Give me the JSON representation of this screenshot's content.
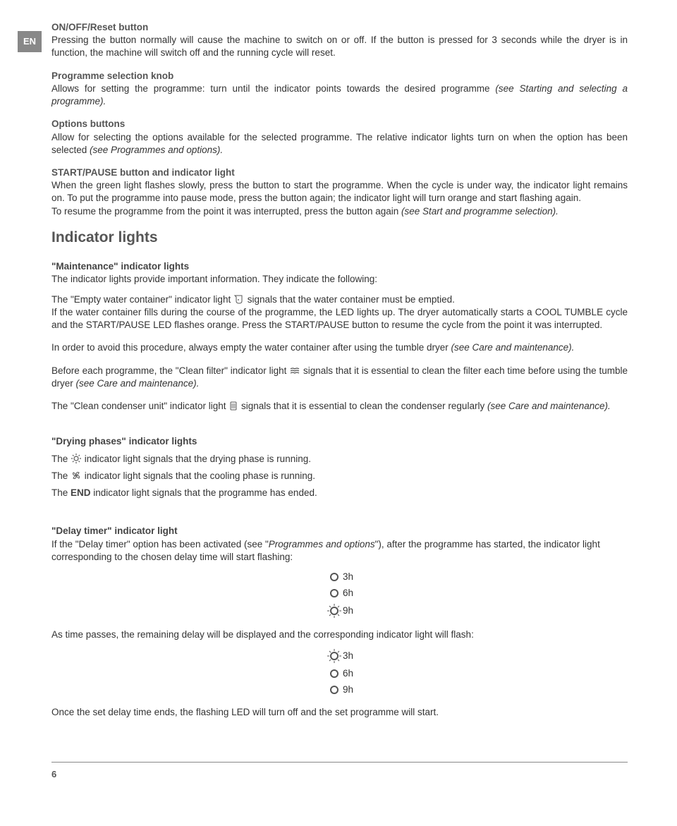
{
  "langBadge": "EN",
  "sections": {
    "onoff": {
      "title": "ON/OFF/Reset button",
      "body_a": "Pressing the button normally will cause the machine to switch on or off. If the button is pressed for 3 seconds while the dryer is in function, the machine will switch off and the running cycle will reset."
    },
    "progKnob": {
      "title": "Programme selection knob",
      "body_a": "Allows for setting the programme: turn until the indicator points towards the desired programme ",
      "body_i": "(see Starting and selecting a programme)."
    },
    "options": {
      "title": "Options buttons",
      "body_a": "Allow for selecting the options available for the selected programme. The relative indicator lights turn on when the option has been selected ",
      "body_i": "(see Programmes and options)."
    },
    "startPause": {
      "title": "START/PAUSE button and indicator light",
      "body_a": "When the green light flashes slowly, press the button to start the programme. When the cycle is under way, the indicator light remains on. To put the programme into pause mode, press the button again; the indicator light will turn orange and start flashing again.",
      "body_b": "To resume the programme from the point it was interrupted, press the button again ",
      "body_i": "(see Start and programme selection)."
    }
  },
  "indicatorHeading": "Indicator lights",
  "maintenance": {
    "subhead": "\"Maintenance\" indicator lights",
    "line1": "The indicator lights provide important information. They indicate the following:",
    "empty_a": "The \"Empty water container\" indicator light ",
    "empty_b": " signals that the water container must be emptied.",
    "empty_c": "If the water container fills during the course of the programme, the LED lights up. The dryer automatically starts a COOL TUMBLE cycle and the START/PAUSE LED flashes orange. Press the START/PAUSE button to resume the cycle from the point it was interrupted.",
    "avoid_a": "In order to avoid this procedure, always empty the water container after using the tumble dryer ",
    "avoid_i": "(see Care and maintenance).",
    "filter_a": "Before each programme, the \"Clean filter\" indicator light ",
    "filter_b": " signals that it is essential to clean the filter each time before using the tumble dryer ",
    "filter_i": "(see Care and maintenance).",
    "cond_a": "The \"Clean condenser unit\" indicator light ",
    "cond_b": " signals that it is essential to clean the condenser regularly ",
    "cond_i": "(see Care and maintenance)."
  },
  "drying": {
    "subhead": "\"Drying phases\" indicator lights",
    "line1_a": "The ",
    "line1_b": " indicator light signals that the drying phase is running.",
    "line2_a": "The ",
    "line2_b": " indicator light signals that the cooling phase is running.",
    "line3_a": "The ",
    "line3_bold": "END",
    "line3_b": " indicator light signals that the programme has ended."
  },
  "delay": {
    "subhead": "\"Delay timer\" indicator light",
    "intro_a": "If the \"Delay timer\" option has been activated (see \"",
    "intro_i": "Programmes and options",
    "intro_b": "\"), after the programme has started, the indicator light corresponding to the chosen delay time will start flashing:",
    "h3": "3h",
    "h6": "6h",
    "h9": "9h",
    "mid": "As time passes, the remaining delay will be displayed and the corresponding indicator light will flash:",
    "end": "Once the set delay time ends, the flashing LED will turn off and the set programme will start."
  },
  "pageNumber": "6"
}
